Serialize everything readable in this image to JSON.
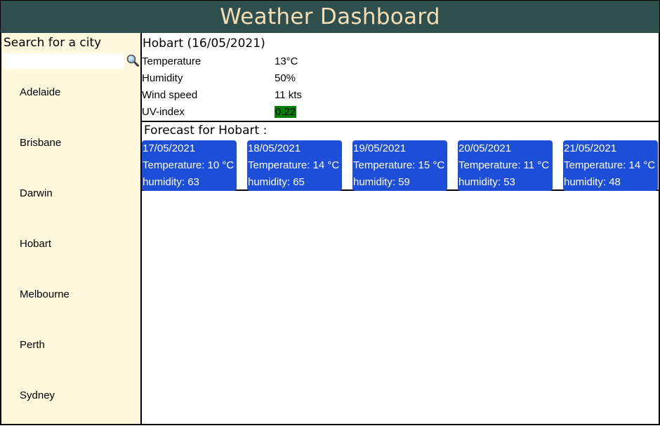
{
  "header": {
    "title": "Weather Dashboard"
  },
  "sidebar": {
    "search_label": "Search for a city",
    "search_value": "",
    "search_placeholder": "",
    "search_icon": "magnifier-icon",
    "cities": [
      "Adelaide",
      "Brisbane",
      "Darwin",
      "Hobart",
      "Melbourne",
      "Perth",
      "Sydney"
    ]
  },
  "current": {
    "title": "Hobart (16/05/2021)",
    "stats": [
      {
        "label": "Temperature",
        "value": "13°C"
      },
      {
        "label": "Humidity",
        "value": "50%"
      },
      {
        "label": "Wind speed",
        "value": "11 kts"
      },
      {
        "label": "UV-index",
        "value": "0.22"
      }
    ],
    "uv_color": "#008000"
  },
  "forecast": {
    "title": "Forecast for Hobart :",
    "days": [
      {
        "date": "17/05/2021",
        "temperature": "Temperature: 10 °C",
        "humidity": "humidity: 63"
      },
      {
        "date": "18/05/2021",
        "temperature": "Temperature: 14 °C",
        "humidity": "humidity: 65"
      },
      {
        "date": "19/05/2021",
        "temperature": "Temperature: 15 °C",
        "humidity": "humidity: 59"
      },
      {
        "date": "20/05/2021",
        "temperature": "Temperature: 11 °C",
        "humidity": "humidity: 53"
      },
      {
        "date": "21/05/2021",
        "temperature": "Temperature: 14 °C",
        "humidity": "humidity: 48"
      }
    ]
  },
  "colors": {
    "header_bg": "#2f4f4f",
    "header_text": "#f5deb3",
    "sidebar_bg": "#fff8dc",
    "card_bg": "#1d4ed8",
    "card_text": "#ffffff"
  }
}
